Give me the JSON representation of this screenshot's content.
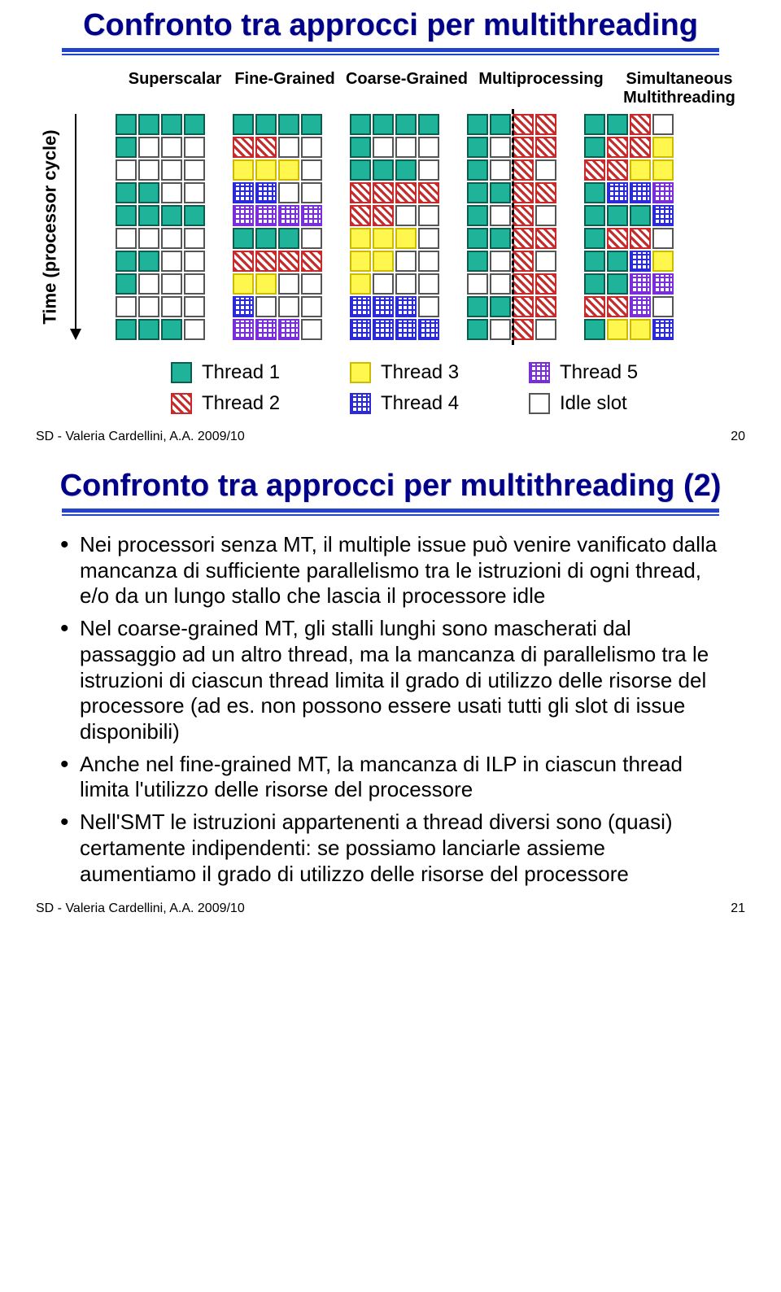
{
  "slide1": {
    "title": "Confronto tra approcci per multithreading",
    "y_axis_label": "Time (processor cycle)",
    "approach_headers": [
      "Superscalar",
      "Fine-Grained",
      "Coarse-Grained",
      "Multiprocessing",
      "Simultaneous Multithreading"
    ],
    "legend": [
      {
        "key": "t1",
        "label": "Thread 1"
      },
      {
        "key": "t3",
        "label": "Thread 3"
      },
      {
        "key": "t5",
        "label": "Thread 5"
      },
      {
        "key": "t2",
        "label": "Thread 2"
      },
      {
        "key": "t4",
        "label": "Thread 4"
      },
      {
        "key": "idle",
        "label": "Idle slot"
      }
    ],
    "footer_left": "SD - Valeria Cardellini, A.A. 2009/10",
    "footer_right": "20"
  },
  "chart_data": {
    "type": "table",
    "title": "Issue-slot occupancy per processor cycle under five multithreading approaches",
    "ylabel": "Time (processor cycle)",
    "rows": 10,
    "issue_width": 4,
    "cell_legend": {
      "1": "Thread 1",
      "2": "Thread 2",
      "3": "Thread 3",
      "4": "Thread 4",
      "5": "Thread 5",
      "0": "Idle slot"
    },
    "approaches": {
      "Superscalar": [
        [
          1,
          1,
          1,
          1
        ],
        [
          1,
          0,
          0,
          0
        ],
        [
          0,
          0,
          0,
          0
        ],
        [
          1,
          1,
          0,
          0
        ],
        [
          1,
          1,
          1,
          1
        ],
        [
          0,
          0,
          0,
          0
        ],
        [
          1,
          1,
          0,
          0
        ],
        [
          1,
          0,
          0,
          0
        ],
        [
          0,
          0,
          0,
          0
        ],
        [
          1,
          1,
          1,
          0
        ]
      ],
      "Fine-Grained": [
        [
          1,
          1,
          1,
          1
        ],
        [
          2,
          2,
          0,
          0
        ],
        [
          3,
          3,
          3,
          0
        ],
        [
          4,
          4,
          0,
          0
        ],
        [
          5,
          5,
          5,
          5
        ],
        [
          1,
          1,
          1,
          0
        ],
        [
          2,
          2,
          2,
          2
        ],
        [
          3,
          3,
          0,
          0
        ],
        [
          4,
          0,
          0,
          0
        ],
        [
          5,
          5,
          5,
          0
        ]
      ],
      "Coarse-Grained": [
        [
          1,
          1,
          1,
          1
        ],
        [
          1,
          0,
          0,
          0
        ],
        [
          1,
          1,
          1,
          0
        ],
        [
          2,
          2,
          2,
          2
        ],
        [
          2,
          2,
          0,
          0
        ],
        [
          3,
          3,
          3,
          0
        ],
        [
          3,
          3,
          0,
          0
        ],
        [
          3,
          0,
          0,
          0
        ],
        [
          4,
          4,
          4,
          0
        ],
        [
          4,
          4,
          4,
          4
        ]
      ],
      "Multiprocessing": [
        [
          1,
          1,
          2,
          2
        ],
        [
          1,
          0,
          2,
          2
        ],
        [
          1,
          0,
          2,
          0
        ],
        [
          1,
          1,
          2,
          2
        ],
        [
          1,
          0,
          2,
          0
        ],
        [
          1,
          1,
          2,
          2
        ],
        [
          1,
          0,
          2,
          0
        ],
        [
          0,
          0,
          2,
          2
        ],
        [
          1,
          1,
          2,
          2
        ],
        [
          1,
          0,
          2,
          0
        ]
      ],
      "Simultaneous Multithreading": [
        [
          1,
          1,
          2,
          0
        ],
        [
          1,
          2,
          2,
          3
        ],
        [
          2,
          2,
          3,
          3
        ],
        [
          1,
          4,
          4,
          5
        ],
        [
          1,
          1,
          1,
          4
        ],
        [
          1,
          2,
          2,
          0
        ],
        [
          1,
          1,
          4,
          3
        ],
        [
          1,
          1,
          5,
          5
        ],
        [
          2,
          2,
          5,
          0
        ],
        [
          1,
          3,
          3,
          4
        ]
      ]
    }
  },
  "slide2": {
    "title": "Confronto tra approcci per multithreading (2)",
    "bullets": [
      "Nei processori senza MT, il multiple issue può venire vanificato dalla mancanza di sufficiente parallelismo tra le istruzioni di ogni thread, e/o da un lungo stallo che lascia il processore idle",
      "Nel coarse-grained MT, gli stalli lunghi sono mascherati dal passaggio ad un altro thread, ma la mancanza di parallelismo tra le istruzioni di ciascun thread limita il grado di utilizzo delle risorse del processore (ad es. non possono essere usati tutti gli slot di issue disponibili)",
      "Anche nel fine-grained MT, la mancanza di ILP in ciascun thread limita l'utilizzo delle risorse del processore",
      "Nell'SMT le istruzioni appartenenti a thread diversi sono (quasi) certamente indipendenti: se possiamo lanciarle assieme aumentiamo il grado di utilizzo delle risorse del processore"
    ],
    "footer_left": "SD - Valeria Cardellini, A.A. 2009/10",
    "footer_right": "21"
  }
}
